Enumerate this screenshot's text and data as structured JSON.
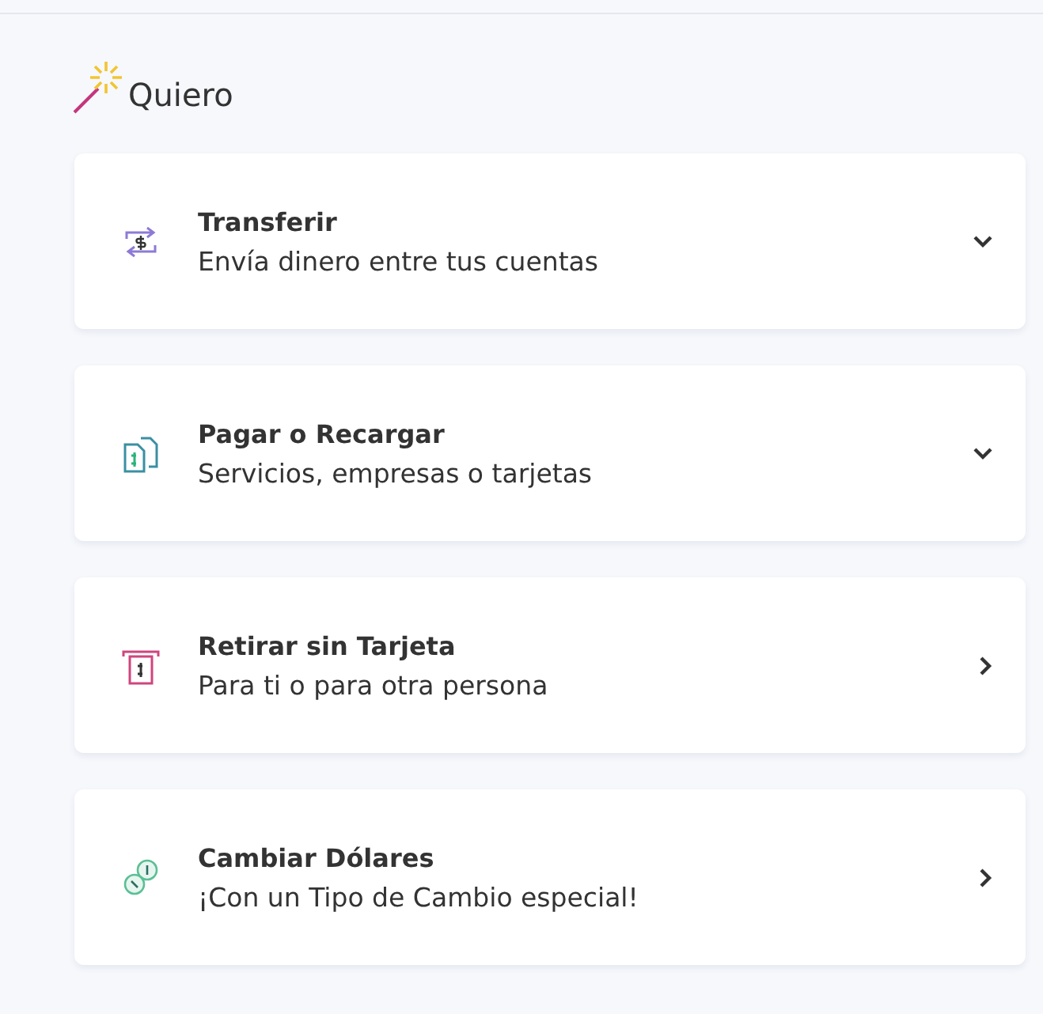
{
  "heading": "Quiero",
  "options": [
    {
      "title": "Transferir",
      "subtitle": "Envía dinero entre tus cuentas",
      "kind": "dropdown"
    },
    {
      "title": "Pagar o Recargar",
      "subtitle": "Servicios, empresas o tarjetas",
      "kind": "dropdown"
    },
    {
      "title": "Retirar sin Tarjeta",
      "subtitle": "Para ti o para otra persona",
      "kind": "link"
    },
    {
      "title": "Cambiar Dólares",
      "subtitle": "¡Con un Tipo de Cambio especial!",
      "kind": "link"
    }
  ]
}
